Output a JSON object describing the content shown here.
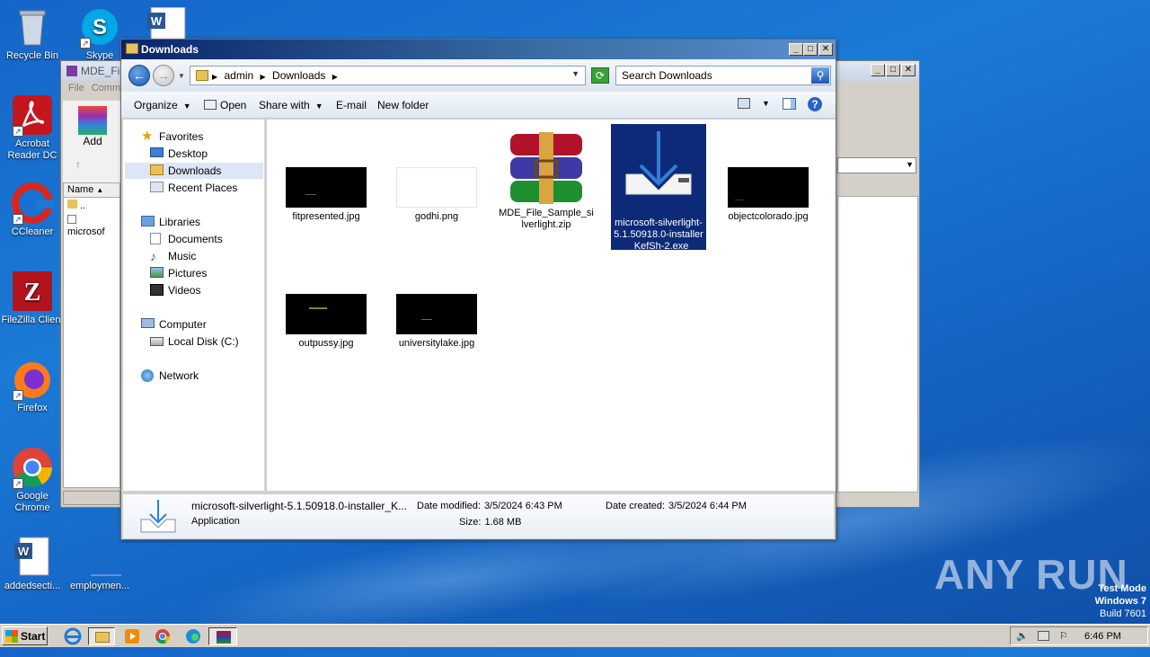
{
  "desktop": {
    "icons": [
      {
        "label": "Recycle Bin",
        "icon": "recycle-bin-icon"
      },
      {
        "label": "Skype",
        "icon": "skype-icon"
      },
      {
        "label": "Acrobat Reader DC",
        "icon": "acrobat-icon"
      },
      {
        "label": "CCleaner",
        "icon": "ccleaner-icon"
      },
      {
        "label": "FileZilla Client",
        "icon": "filezilla-icon"
      },
      {
        "label": "Firefox",
        "icon": "firefox-icon"
      },
      {
        "label": "Google Chrome",
        "icon": "chrome-icon"
      },
      {
        "label": "addedsecti...",
        "icon": "word-doc-icon"
      },
      {
        "label": "employmen...",
        "icon": "file-icon"
      }
    ]
  },
  "back_window": {
    "title": "MDE_Fil",
    "menu": [
      "File",
      "Comm"
    ],
    "add_label": "Add",
    "column_name": "Name",
    "rows": [
      "..",
      "microsof"
    ]
  },
  "window": {
    "title": "Downloads",
    "address": {
      "crumbs": [
        "admin",
        "Downloads"
      ]
    },
    "search_placeholder": "Search Downloads",
    "toolbar": {
      "organize": "Organize",
      "open": "Open",
      "share_with": "Share with",
      "email": "E-mail",
      "new_folder": "New folder"
    },
    "nav": {
      "favorites": "Favorites",
      "desktop": "Desktop",
      "downloads": "Downloads",
      "recent_places": "Recent Places",
      "libraries": "Libraries",
      "documents": "Documents",
      "music": "Music",
      "pictures": "Pictures",
      "videos": "Videos",
      "computer": "Computer",
      "local_disk": "Local Disk (C:)",
      "network": "Network"
    },
    "files": [
      {
        "name": "fitpresented.jpg",
        "type": "image-dark"
      },
      {
        "name": "godhi.png",
        "type": "image-white"
      },
      {
        "name": "MDE_File_Sample_silverlight.zip",
        "type": "winrar-archive"
      },
      {
        "name": "microsoft-silverlight-5.1.50918.0-installer_KefSh-2.exe",
        "type": "installer",
        "selected": true
      },
      {
        "name": "objectcolorado.jpg",
        "type": "image-dark"
      },
      {
        "name": "outpussy.jpg",
        "type": "image-dark"
      },
      {
        "name": "universitylake.jpg",
        "type": "image-dark"
      }
    ],
    "details": {
      "name": "microsoft-silverlight-5.1.50918.0-installer_K...",
      "type": "Application",
      "date_modified_label": "Date modified:",
      "date_modified": "3/5/2024 6:43 PM",
      "size_label": "Size:",
      "size": "1.68 MB",
      "date_created_label": "Date created:",
      "date_created": "3/5/2024 6:44 PM"
    }
  },
  "taskbar": {
    "start_label": "Start",
    "clock": "6:46 PM"
  },
  "watermark": {
    "line1": "Test Mode",
    "line2": "Windows 7",
    "line3": "Build 7601"
  },
  "brand": "ANY RUN"
}
